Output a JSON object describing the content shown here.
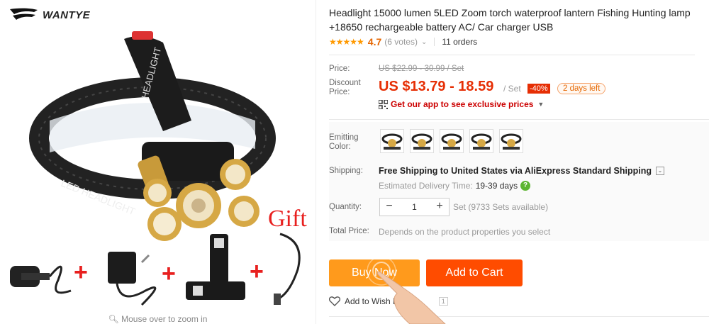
{
  "gallery": {
    "brand": "WANTYE",
    "gift_label": "Gift",
    "zoom_hint": "Mouse over to zoom in"
  },
  "product": {
    "title": "Headlight 15000 lumen 5LED Zoom torch waterproof lantern Fishing Hunting lamp +18650 rechargeable battery AC/ Car charger USB",
    "rating_stars": "★★★★★",
    "rating_value": "4.7",
    "votes": "(6 votes)",
    "orders": "11 orders"
  },
  "pricing": {
    "price_label": "Price:",
    "old_price": "US $22.99 - 30.99 / Set",
    "discount_label": "Discount Price:",
    "discount_price": "US $13.79 - 18.59",
    "per_unit": "/ Set",
    "discount_badge": "-40%",
    "days_left": "2 days left",
    "app_promo": "Get our app to see exclusive prices"
  },
  "options": {
    "color_label": "Emitting Color:",
    "color_count": 5
  },
  "shipping": {
    "label": "Shipping:",
    "text": "Free Shipping to United States via AliExpress Standard Shipping",
    "delivery_label": "Estimated Delivery Time:",
    "delivery_days": "19-39 days"
  },
  "quantity": {
    "label": "Quantity:",
    "minus": "−",
    "value": "1",
    "plus": "+",
    "available": "Set (9733 Sets available)"
  },
  "total": {
    "label": "Total Price:",
    "text": "Depends on the product properties you select"
  },
  "actions": {
    "buy_now": "Buy Now",
    "add_to_cart": "Add to Cart",
    "wishlist": "Add to Wish List",
    "wishlist_count": "1"
  },
  "colors": {
    "price_red": "#e62e04",
    "buy_orange": "#ff9a1c",
    "cart_orange": "#ff4c00",
    "star_orange": "#ff9900"
  }
}
